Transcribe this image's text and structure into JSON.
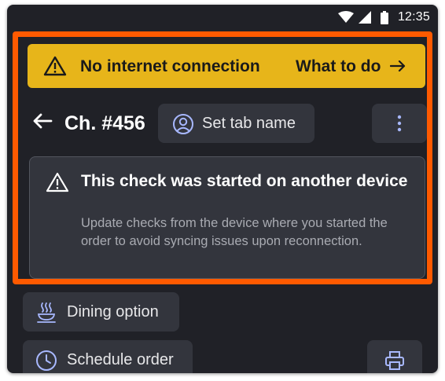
{
  "status_bar": {
    "time": "12:35",
    "icons": [
      "wifi-icon",
      "signal-icon",
      "battery-icon"
    ]
  },
  "banner": {
    "icon": "warning-icon",
    "title": "No internet connection",
    "action_label": "What to do",
    "action_icon": "arrow-right-icon",
    "color": "#e7b51a"
  },
  "header": {
    "back_icon": "arrow-left-icon",
    "check_title": "Ch. #456",
    "tab_button_icon": "user-circle-icon",
    "tab_button_label": "Set tab name",
    "more_icon": "more-vertical-icon"
  },
  "notice": {
    "icon": "warning-icon",
    "title": "This check was started on another device",
    "body": "Update checks from the device where you started the order to avoid syncing issues upon reconnection."
  },
  "options": {
    "dining_icon": "dining-icon",
    "dining_label": "Dining option",
    "schedule_icon": "clock-icon",
    "schedule_label": "Schedule order",
    "print_icon": "printer-icon"
  },
  "colors": {
    "background": "#202127",
    "surface": "#33353d",
    "highlight": "#ff5a00",
    "accent": "#a8b8ff"
  }
}
